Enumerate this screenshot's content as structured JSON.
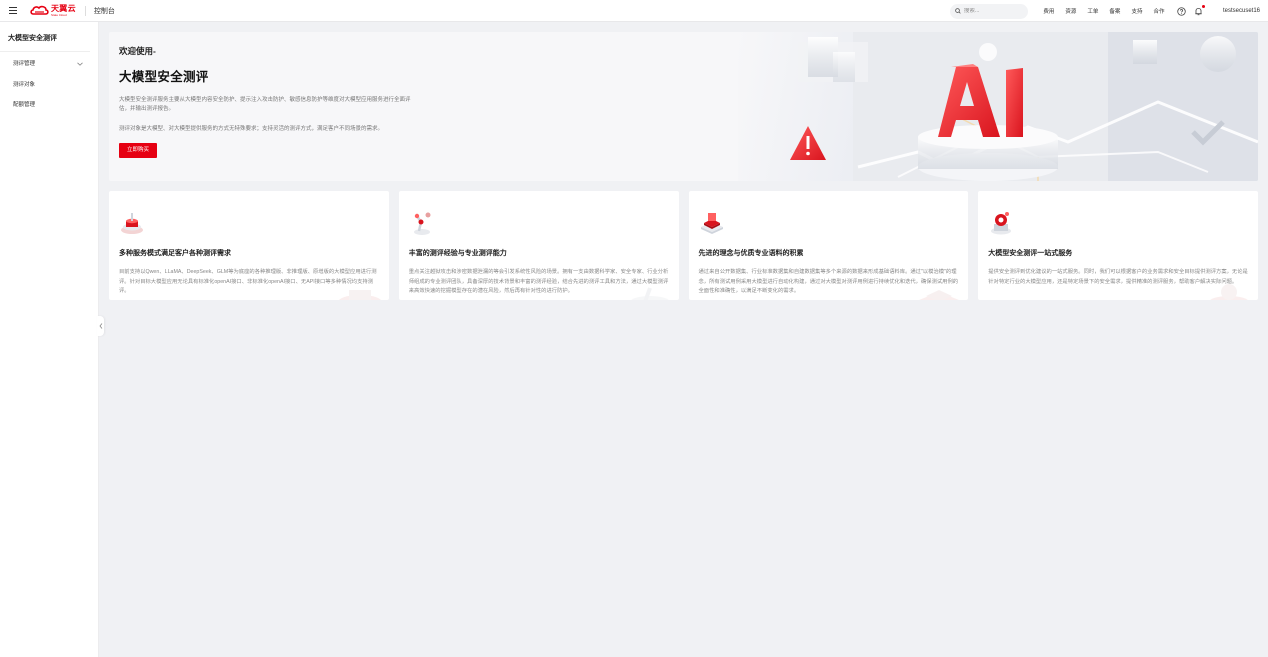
{
  "topbar": {
    "logo_cn": "天翼云",
    "logo_en": "State Cloud",
    "console": "控制台",
    "search_placeholder": "搜索...",
    "nav": [
      "费用",
      "资源",
      "工单",
      "备案",
      "支持",
      "合作"
    ],
    "user": "testsecuset16"
  },
  "sidebar": {
    "title": "大模型安全测评",
    "items": [
      {
        "label": "测评管理"
      },
      {
        "label": "测评对象"
      },
      {
        "label": "配额管理"
      }
    ]
  },
  "banner": {
    "welcome": "欢迎使用-",
    "title": "大模型安全测评",
    "desc": "大模型安全测评服务主要从大模型内容安全防护、提示注入攻击防护、敏感信息防护等维度对大模型应用服务进行全面评估，并输出测评报告。",
    "desc2": "测评对象是大模型、对大模型提供服务的方式无特殊要求；支持灵活的测评方式，满足客户不同场景的需求。",
    "button": "立即购买"
  },
  "cards": [
    {
      "title": "多种服务模式满足客户各种测评需求",
      "desc": "目前支持以Qwen、LLaMA、DeepSeek、GLM等为底座的各种推理版、非推理版、原增版的大模型应用进行测评。针对目标大模型应用无论具有标准化openAI接口、非标准化openAI接口、无API接口等多种情况均支持测评。"
    },
    {
      "title": "丰富的测评经验与专业测评能力",
      "desc": "重点关注越狱攻击和涉密数据泄漏的等会引发系统性风险的场景。拥有一支由数据科学家、安全专家、行业分析师组成的专业测评团队，具备深厚的技术背景和丰富的测评经验，结合先进的测评工具和方法，通过大模型测评来高效快速的挖掘模型存在的潜在风险，然后再有针对性的进行防护。"
    },
    {
      "title": "先进的理念与优质专业语料的积累",
      "desc": "通过来自公开数据集、行业标准数据集和自建数据集等多个来源的数据来形成基础语料库。通过\"以模治模\"的理念，所有测试用例采用大模型进行自动化构建，通过对大模型对测评用例进行持续优化和迭代，确保测试用例的全面性和准确性，以满足不断变化的需求。"
    },
    {
      "title": "大模型安全测评一站式服务",
      "desc": "提供安全测评到优化建议的一站式服务。同时，我们可以根据客户的业务需求和安全目标提供测评方案，无论是针对特定行业的大模型应用，还是特定场景下的安全需求，提供精准的测评服务，帮助客户解决实际问题。"
    }
  ],
  "colors": {
    "brand": "#e60012",
    "background": "#f0f1f4"
  },
  "icons": [
    "menu-icon",
    "search-icon",
    "help-icon",
    "bell-icon",
    "chevron-down-icon",
    "chevron-left-icon"
  ]
}
